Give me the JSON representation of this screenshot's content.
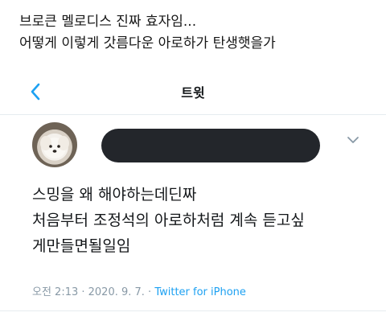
{
  "caption": {
    "line1": "브로큰 멜로디스 진짜 효자임...",
    "line2": "어떻게 이렇게 갓름다운 아로하가 탄생햇을가"
  },
  "navbar": {
    "back_icon": "chevron-left-icon",
    "title": "트윗"
  },
  "tweet": {
    "author_name_redacted": true,
    "more_icon": "chevron-down-icon",
    "lines": [
      "스밍을 왜 해야하는데딘짜",
      "처음부터 조정석의 아로하처럼 계속 듣고싶",
      "게만들면될일임"
    ],
    "timestamp": "오전 2:13 · 2020. 9. 7. · ",
    "source": "Twitter for iPhone"
  },
  "colors": {
    "accent": "#1da1f2",
    "meta_text": "#8899a6",
    "redaction": "#23262b"
  }
}
